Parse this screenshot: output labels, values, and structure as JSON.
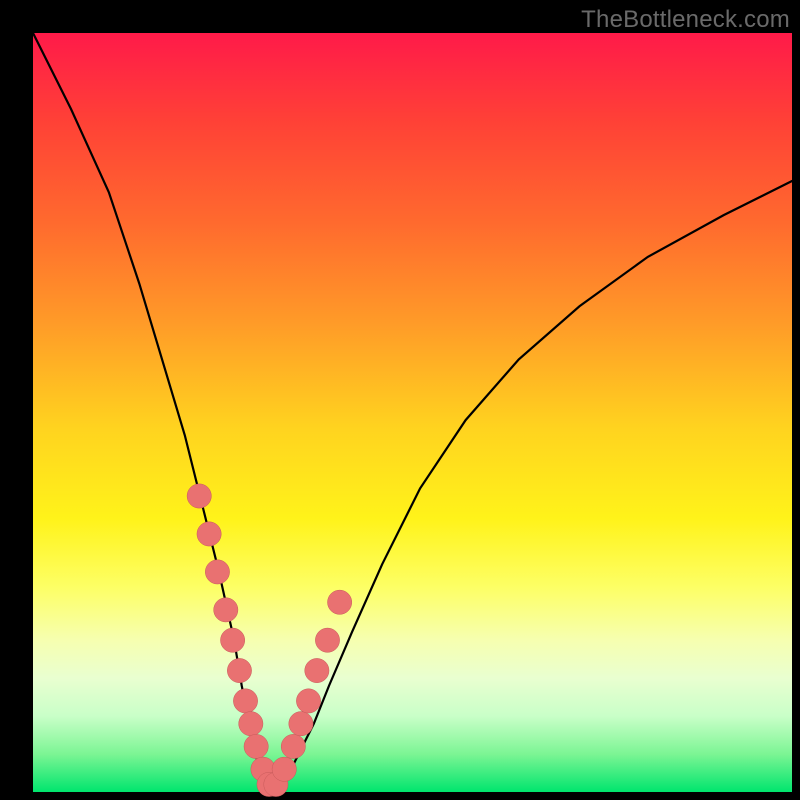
{
  "watermark": "TheBottleneck.com",
  "colors": {
    "frame": "#000000",
    "gradient_top": "#ff1a49",
    "gradient_bottom": "#00e56e",
    "curve": "#000000",
    "dot_fill": "#e97171",
    "dot_stroke": "#c85a5a"
  },
  "chart_data": {
    "type": "line",
    "title": "",
    "xlabel": "",
    "ylabel": "",
    "xlim": [
      0,
      100
    ],
    "ylim": [
      0,
      100
    ],
    "grid": false,
    "series": [
      {
        "name": "bottleneck-curve",
        "x": [
          0,
          5,
          10,
          14,
          17,
          20,
          22.5,
          24.5,
          26.5,
          27.5,
          28.5,
          29.3,
          30.1,
          31,
          32,
          33.5,
          35,
          37,
          39,
          42,
          46,
          51,
          57,
          64,
          72,
          81,
          91,
          100
        ],
        "values": [
          100,
          90,
          79,
          67,
          57,
          47,
          37,
          29,
          20,
          14,
          9,
          5,
          2,
          0.5,
          0.5,
          2,
          5,
          9,
          14,
          21,
          30,
          40,
          49,
          57,
          64,
          70.5,
          76,
          80.5
        ]
      }
    ],
    "points": {
      "name": "highlighted-samples",
      "x": [
        21.9,
        23.2,
        24.3,
        25.4,
        26.3,
        27.2,
        28.0,
        28.7,
        29.4,
        30.3,
        31.1,
        32.0,
        33.1,
        34.3,
        35.3,
        36.3,
        37.4,
        38.8,
        40.4
      ],
      "values": [
        39,
        34,
        29,
        24,
        20,
        16,
        12,
        9,
        6,
        3,
        1,
        1,
        3,
        6,
        9,
        12,
        16,
        20,
        25
      ]
    },
    "point_radius": 1.6
  }
}
